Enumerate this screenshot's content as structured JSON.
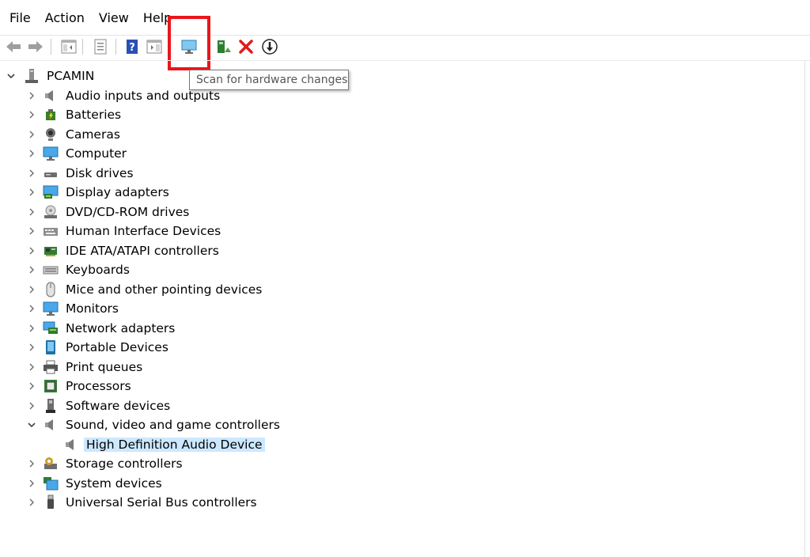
{
  "menu": [
    "File",
    "Action",
    "View",
    "Help"
  ],
  "tooltip": "Scan for hardware changes",
  "tree": {
    "root": {
      "label": "PCAMIN",
      "icon": "computer-tree-icon"
    },
    "categories": [
      {
        "label": "Audio inputs and outputs",
        "icon": "speaker-icon",
        "expanded": false
      },
      {
        "label": "Batteries",
        "icon": "battery-icon",
        "expanded": false
      },
      {
        "label": "Cameras",
        "icon": "camera-icon",
        "expanded": false
      },
      {
        "label": "Computer",
        "icon": "monitor-icon",
        "expanded": false
      },
      {
        "label": "Disk drives",
        "icon": "disk-drive-icon",
        "expanded": false
      },
      {
        "label": "Display adapters",
        "icon": "display-adapter-icon",
        "expanded": false
      },
      {
        "label": "DVD/CD-ROM drives",
        "icon": "dvd-drive-icon",
        "expanded": false
      },
      {
        "label": "Human Interface Devices",
        "icon": "hid-icon",
        "expanded": false
      },
      {
        "label": "IDE ATA/ATAPI controllers",
        "icon": "ide-controller-icon",
        "expanded": false
      },
      {
        "label": "Keyboards",
        "icon": "keyboard-icon",
        "expanded": false
      },
      {
        "label": "Mice and other pointing devices",
        "icon": "mouse-icon",
        "expanded": false
      },
      {
        "label": "Monitors",
        "icon": "monitor-icon",
        "expanded": false
      },
      {
        "label": "Network adapters",
        "icon": "network-adapter-icon",
        "expanded": false
      },
      {
        "label": "Portable Devices",
        "icon": "portable-device-icon",
        "expanded": false
      },
      {
        "label": "Print queues",
        "icon": "printer-icon",
        "expanded": false
      },
      {
        "label": "Processors",
        "icon": "processor-icon",
        "expanded": false
      },
      {
        "label": "Software devices",
        "icon": "software-device-icon",
        "expanded": false
      },
      {
        "label": "Sound, video and game controllers",
        "icon": "speaker-icon",
        "expanded": true,
        "children": [
          {
            "label": "High Definition Audio Device",
            "icon": "speaker-icon",
            "selected": true
          }
        ]
      },
      {
        "label": "Storage controllers",
        "icon": "storage-controller-icon",
        "expanded": false
      },
      {
        "label": "System devices",
        "icon": "system-devices-icon",
        "expanded": false
      },
      {
        "label": "Universal Serial Bus controllers",
        "icon": "usb-icon",
        "expanded": false
      }
    ]
  },
  "colors": {
    "highlight_box": "#e8161b",
    "selection": "#cce8ff",
    "accent_blue": "#1e90d8"
  }
}
